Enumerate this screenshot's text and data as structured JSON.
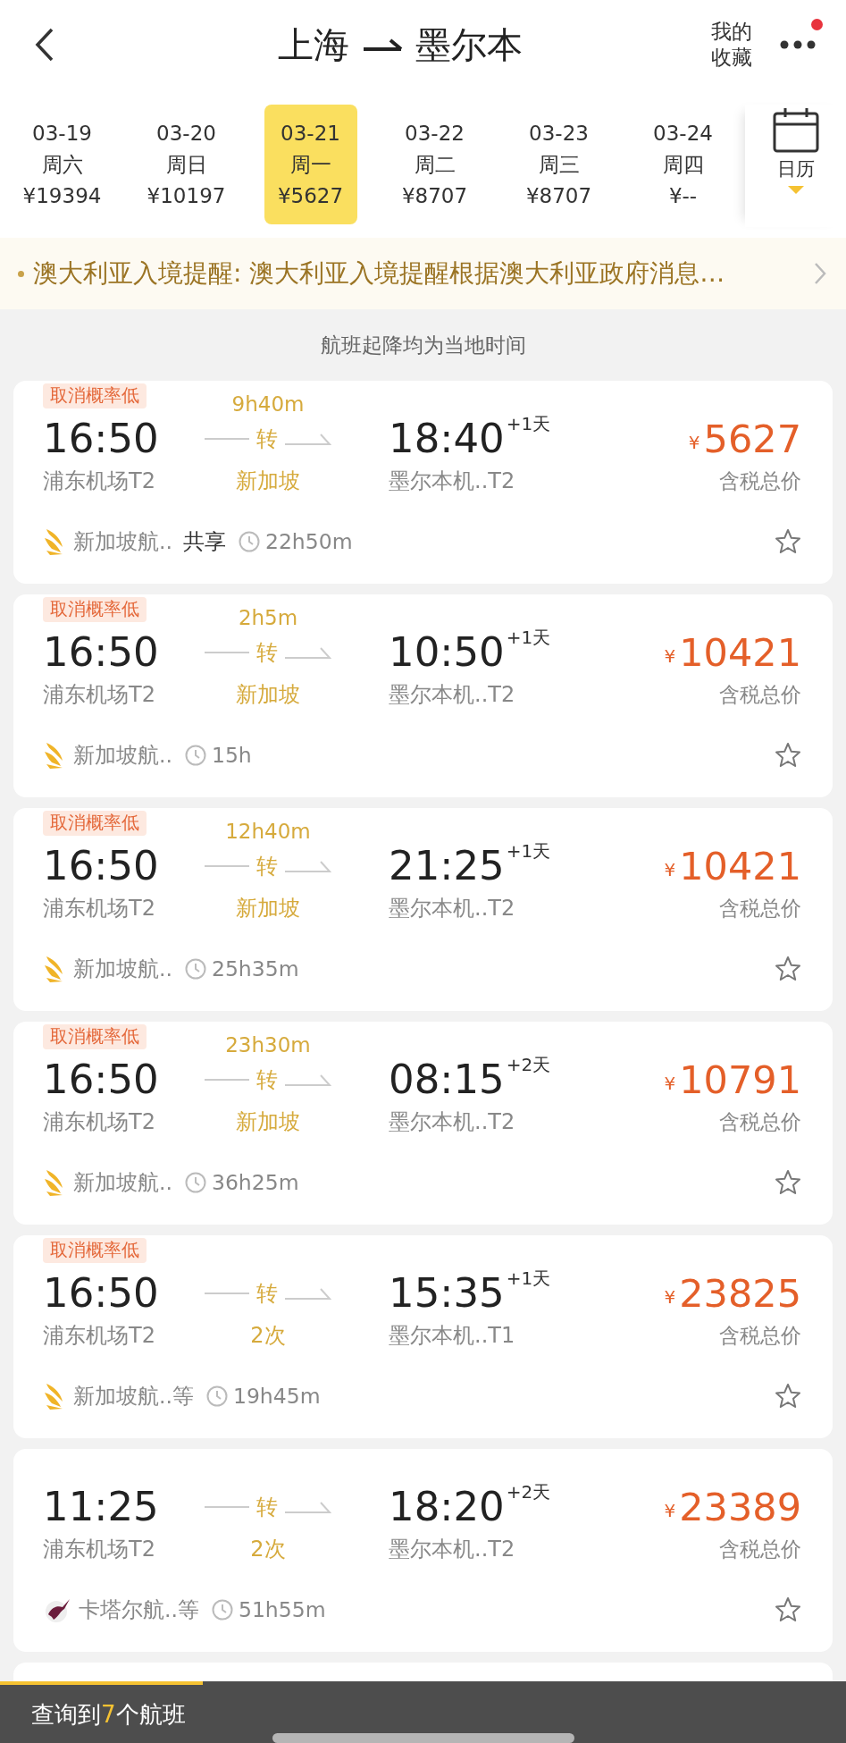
{
  "header": {
    "from": "上海",
    "to": "墨尔本",
    "favorites": "我的收藏",
    "has_notification": true
  },
  "dates": [
    {
      "date": "03-19",
      "weekday": "周六",
      "price": "¥19394",
      "selected": false
    },
    {
      "date": "03-20",
      "weekday": "周日",
      "price": "¥10197",
      "selected": false
    },
    {
      "date": "03-21",
      "weekday": "周一",
      "price": "¥5627",
      "selected": true
    },
    {
      "date": "03-22",
      "weekday": "周二",
      "price": "¥8707",
      "selected": false
    },
    {
      "date": "03-23",
      "weekday": "周三",
      "price": "¥8707",
      "selected": false
    },
    {
      "date": "03-24",
      "weekday": "周四",
      "price": "¥--",
      "selected": false
    }
  ],
  "calendar": {
    "label": "日历"
  },
  "notice": {
    "text": "澳大利亚入境提醒: 澳大利亚入境提醒根据澳大利亚政府消息…"
  },
  "hint": "航班起降均为当地时间",
  "flights": [
    {
      "tag": "取消概率低",
      "dep_time": "16:50",
      "dep_airport": "浦东机场T2",
      "via_top": "9h40m",
      "via_mark": "转",
      "via_bottom": "新加坡",
      "arr_time": "18:40",
      "day_offset": "+1天",
      "arr_airport": "墨尔本机..T2",
      "currency": "¥",
      "price": "5627",
      "price_label": "含税总价",
      "kind": "singapore",
      "airline": "新加坡航..",
      "codeshare": "共享",
      "duration": "22h50m",
      "starred": false
    },
    {
      "tag": "取消概率低",
      "dep_time": "16:50",
      "dep_airport": "浦东机场T2",
      "via_top": "2h5m",
      "via_mark": "转",
      "via_bottom": "新加坡",
      "arr_time": "10:50",
      "day_offset": "+1天",
      "arr_airport": "墨尔本机..T2",
      "currency": "¥",
      "price": "10421",
      "price_label": "含税总价",
      "kind": "singapore",
      "airline": "新加坡航..",
      "duration": "15h",
      "starred": false
    },
    {
      "tag": "取消概率低",
      "dep_time": "16:50",
      "dep_airport": "浦东机场T2",
      "via_top": "12h40m",
      "via_mark": "转",
      "via_bottom": "新加坡",
      "arr_time": "21:25",
      "day_offset": "+1天",
      "arr_airport": "墨尔本机..T2",
      "currency": "¥",
      "price": "10421",
      "price_label": "含税总价",
      "kind": "singapore",
      "airline": "新加坡航..",
      "duration": "25h35m",
      "starred": false
    },
    {
      "tag": "取消概率低",
      "dep_time": "16:50",
      "dep_airport": "浦东机场T2",
      "via_top": "23h30m",
      "via_mark": "转",
      "via_bottom": "新加坡",
      "arr_time": "08:15",
      "day_offset": "+2天",
      "arr_airport": "墨尔本机..T2",
      "currency": "¥",
      "price": "10791",
      "price_label": "含税总价",
      "kind": "singapore",
      "airline": "新加坡航..",
      "duration": "36h25m",
      "starred": false
    },
    {
      "tag": "取消概率低",
      "dep_time": "16:50",
      "dep_airport": "浦东机场T2",
      "via_mark": "转",
      "via_bottom": "2次",
      "arr_time": "15:35",
      "day_offset": "+1天",
      "arr_airport": "墨尔本机..T1",
      "currency": "¥",
      "price": "23825",
      "price_label": "含税总价",
      "kind": "singapore",
      "airline": "新加坡航..等",
      "duration": "19h45m",
      "starred": false
    },
    {
      "dep_time": "11:25",
      "dep_airport": "浦东机场T2",
      "via_mark": "转",
      "via_bottom": "2次",
      "arr_time": "18:20",
      "day_offset": "+2天",
      "arr_airport": "墨尔本机..T2",
      "currency": "¥",
      "price": "23389",
      "price_label": "含税总价",
      "kind": "qatar",
      "airline": "卡塔尔航..等",
      "duration": "51h55m",
      "starred": false
    }
  ],
  "bottom_bar": {
    "prefix": "查询到",
    "count": "7",
    "suffix": "个航班",
    "progress": {
      "level": 0.24
    }
  }
}
